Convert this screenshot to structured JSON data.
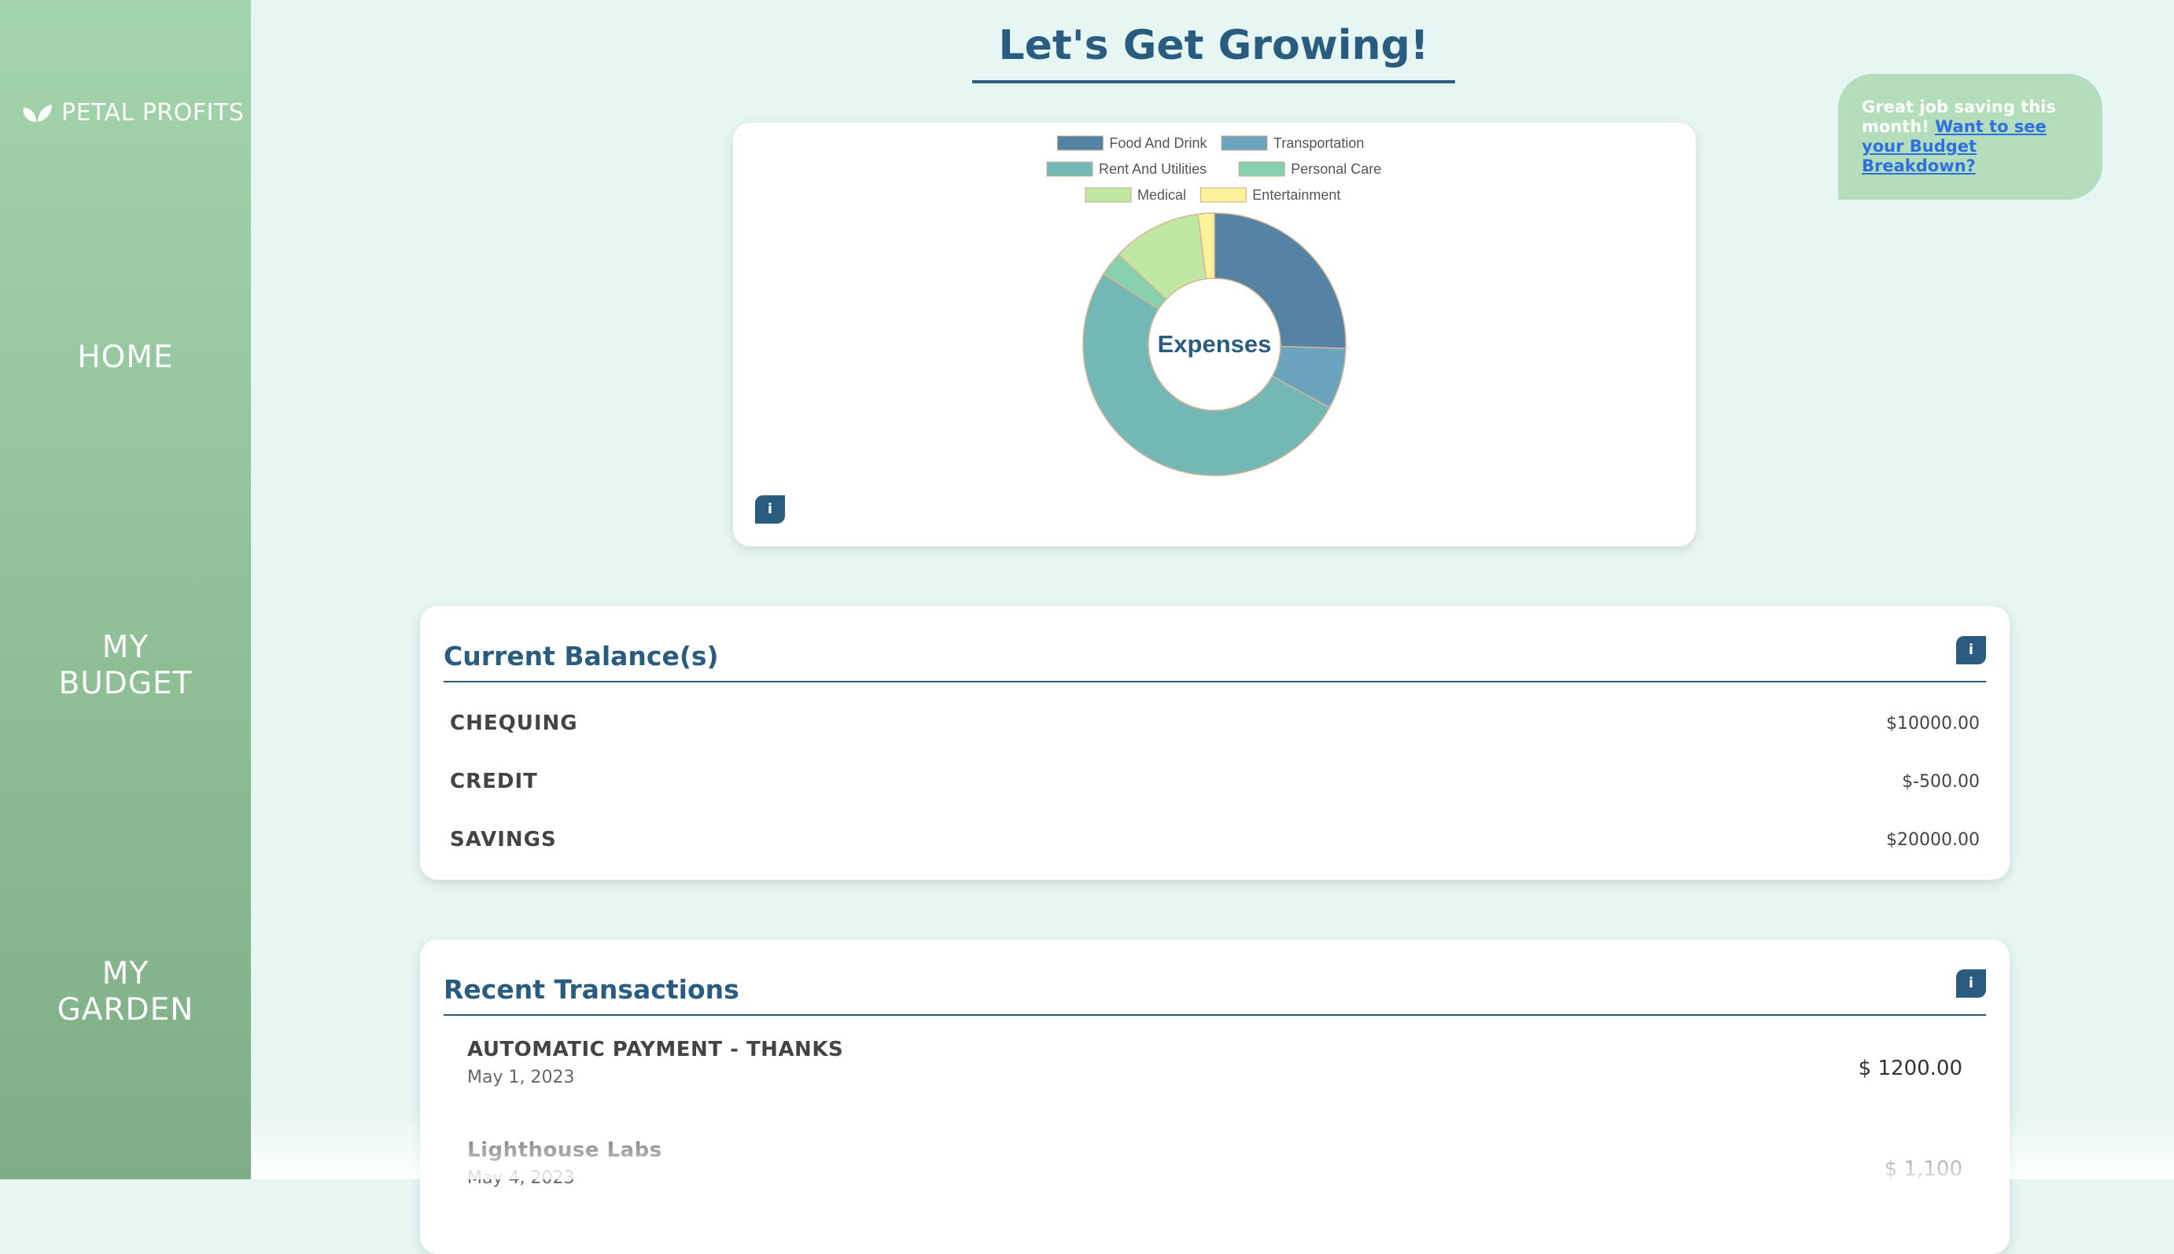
{
  "brand": {
    "name": "PETAL PROFITS",
    "icon": "leaf-icon"
  },
  "nav": [
    {
      "lines": [
        "HOME"
      ]
    },
    {
      "lines": [
        "MY",
        "BUDGET"
      ]
    },
    {
      "lines": [
        "MY",
        "GARDEN"
      ]
    }
  ],
  "header": {
    "title": "Let's Get Growing!"
  },
  "tip": {
    "text": "Great job saving this month!",
    "link": "Want to see your Budget Breakdown?"
  },
  "info_label": "i",
  "chart_data": {
    "type": "pie",
    "title": "Expenses",
    "legend": [
      "Food And Drink",
      "Transportation",
      "Rent And Utilities",
      "Personal Care",
      "Medical",
      "Entertainment"
    ],
    "values": [
      25.5,
      7.5,
      51,
      3,
      11,
      2
    ],
    "colors": [
      "#5583a3",
      "#6aa4bd",
      "#74b8b5",
      "#86d0ae",
      "#c1e8a2",
      "#fdf29a"
    ]
  },
  "balances": {
    "title": "Current Balance(s)",
    "rows": [
      {
        "name": "CHEQUING",
        "amount": "$10000.00"
      },
      {
        "name": "CREDIT",
        "amount": "$-500.00"
      },
      {
        "name": "SAVINGS",
        "amount": "$20000.00"
      }
    ]
  },
  "transactions": {
    "title": "Recent Transactions",
    "rows": [
      {
        "desc": "AUTOMATIC PAYMENT - THANKS",
        "date": "May 1, 2023",
        "amount": "$ 1200.00"
      },
      {
        "desc": "Lighthouse Labs",
        "date": "May 4, 2023",
        "amount": "$ 1,100"
      }
    ]
  }
}
